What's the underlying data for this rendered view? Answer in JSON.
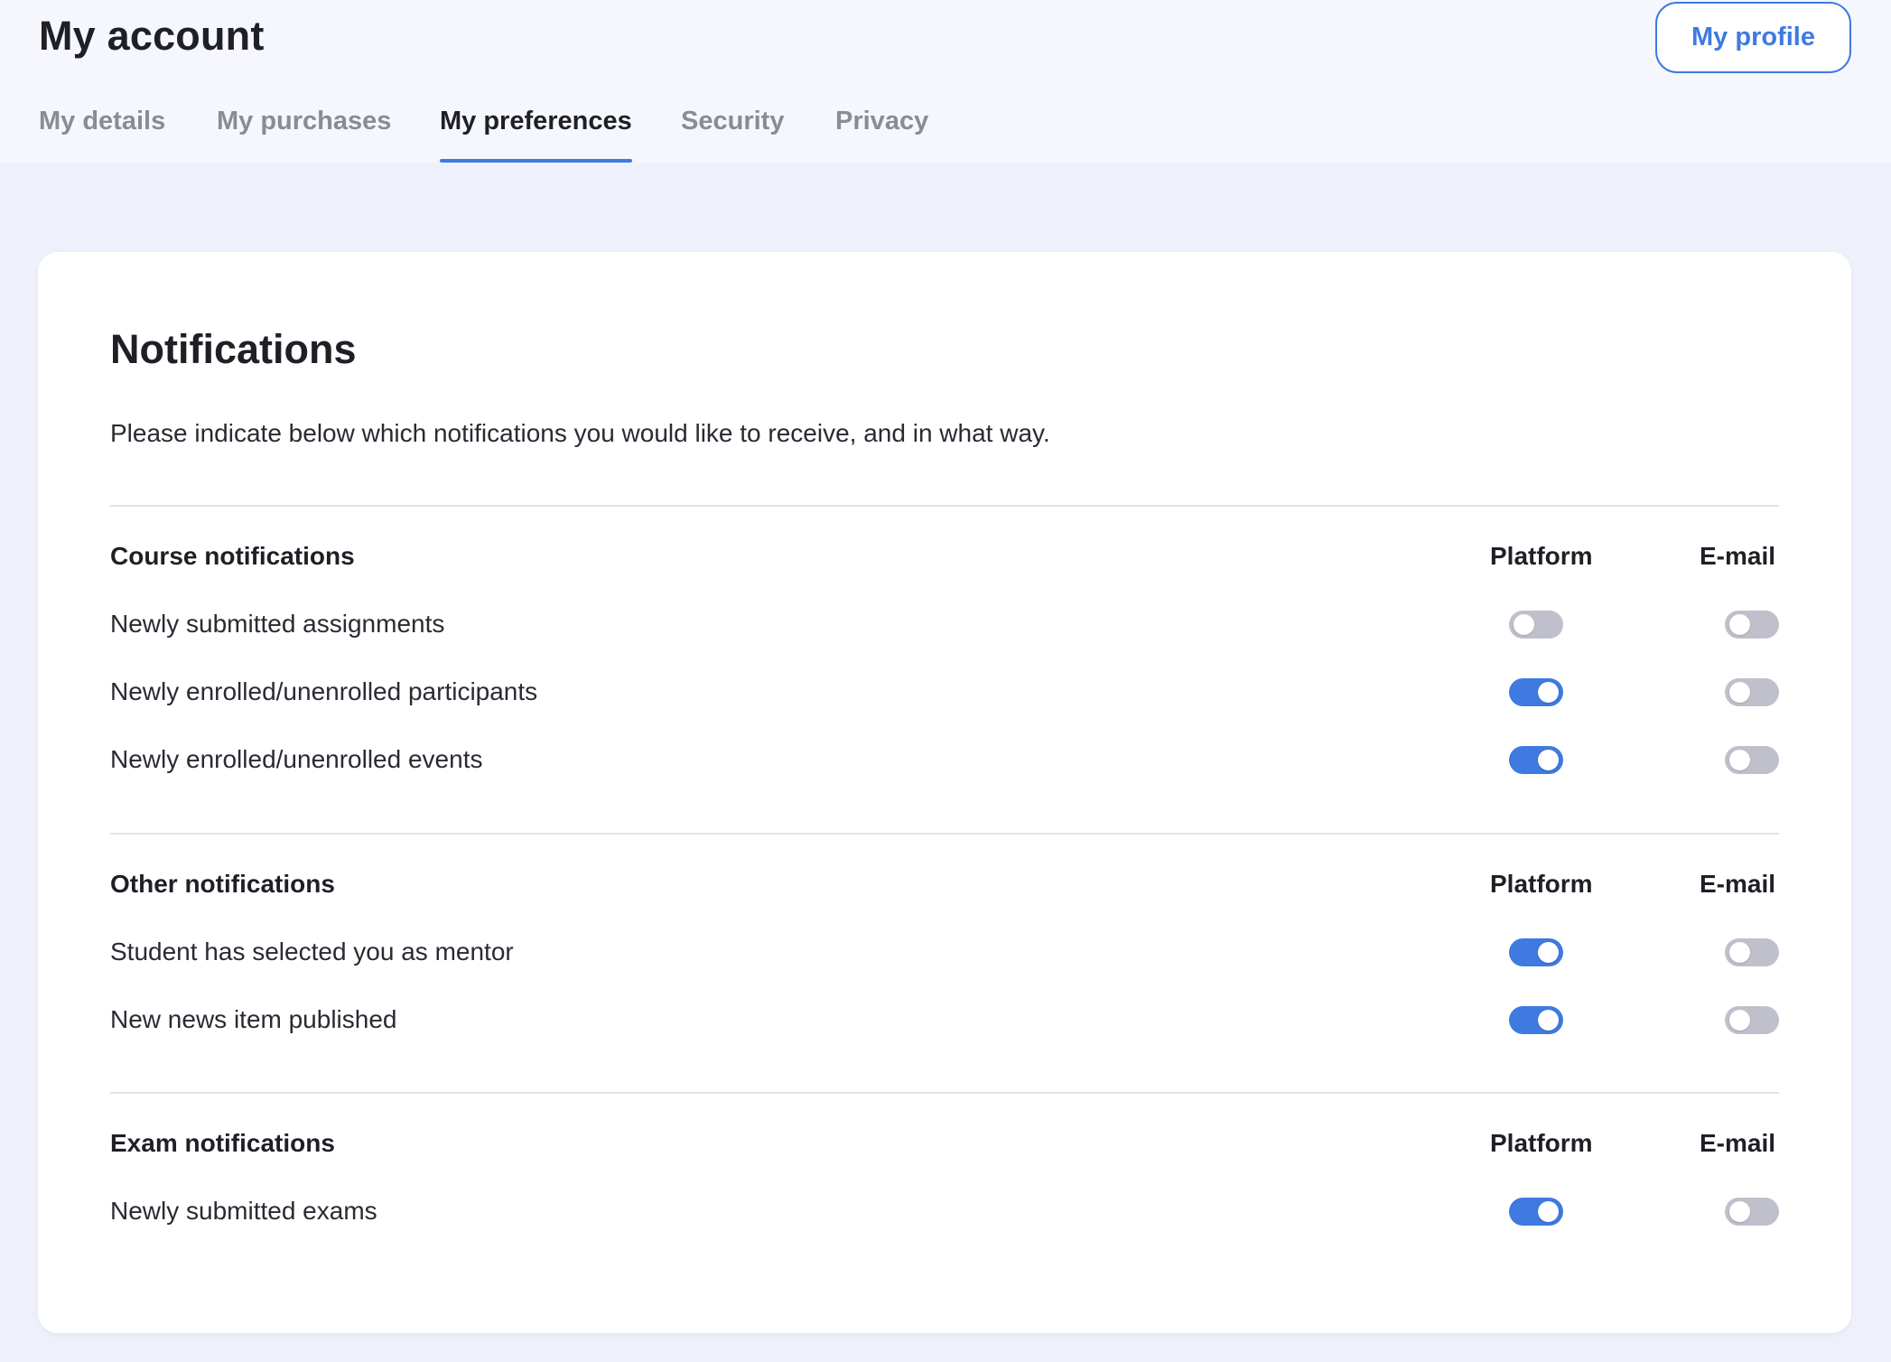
{
  "header": {
    "title": "My account",
    "profile_button": "My profile"
  },
  "tabs": [
    {
      "label": "My details",
      "active": false
    },
    {
      "label": "My purchases",
      "active": false
    },
    {
      "label": "My preferences",
      "active": true
    },
    {
      "label": "Security",
      "active": false
    },
    {
      "label": "Privacy",
      "active": false
    }
  ],
  "notifications": {
    "title": "Notifications",
    "description": "Please indicate below which notifications you would like to receive, and in what way.",
    "column_platform": "Platform",
    "column_email": "E-mail",
    "sections": [
      {
        "heading": "Course notifications",
        "items": [
          {
            "label": "Newly submitted assignments",
            "platform": false,
            "email": false
          },
          {
            "label": "Newly enrolled/unenrolled participants",
            "platform": true,
            "email": false
          },
          {
            "label": "Newly enrolled/unenrolled events",
            "platform": true,
            "email": false
          }
        ]
      },
      {
        "heading": "Other notifications",
        "items": [
          {
            "label": "Student has selected you as mentor",
            "platform": true,
            "email": false
          },
          {
            "label": "New news item published",
            "platform": true,
            "email": false
          }
        ]
      },
      {
        "heading": "Exam notifications",
        "items": [
          {
            "label": "Newly submitted exams",
            "platform": true,
            "email": false
          }
        ]
      }
    ]
  },
  "colors": {
    "accent": "#3f7ae0",
    "toggle_off": "#bfc0cc",
    "page_background": "#eef1fb",
    "header_background": "#f5f7fc"
  }
}
